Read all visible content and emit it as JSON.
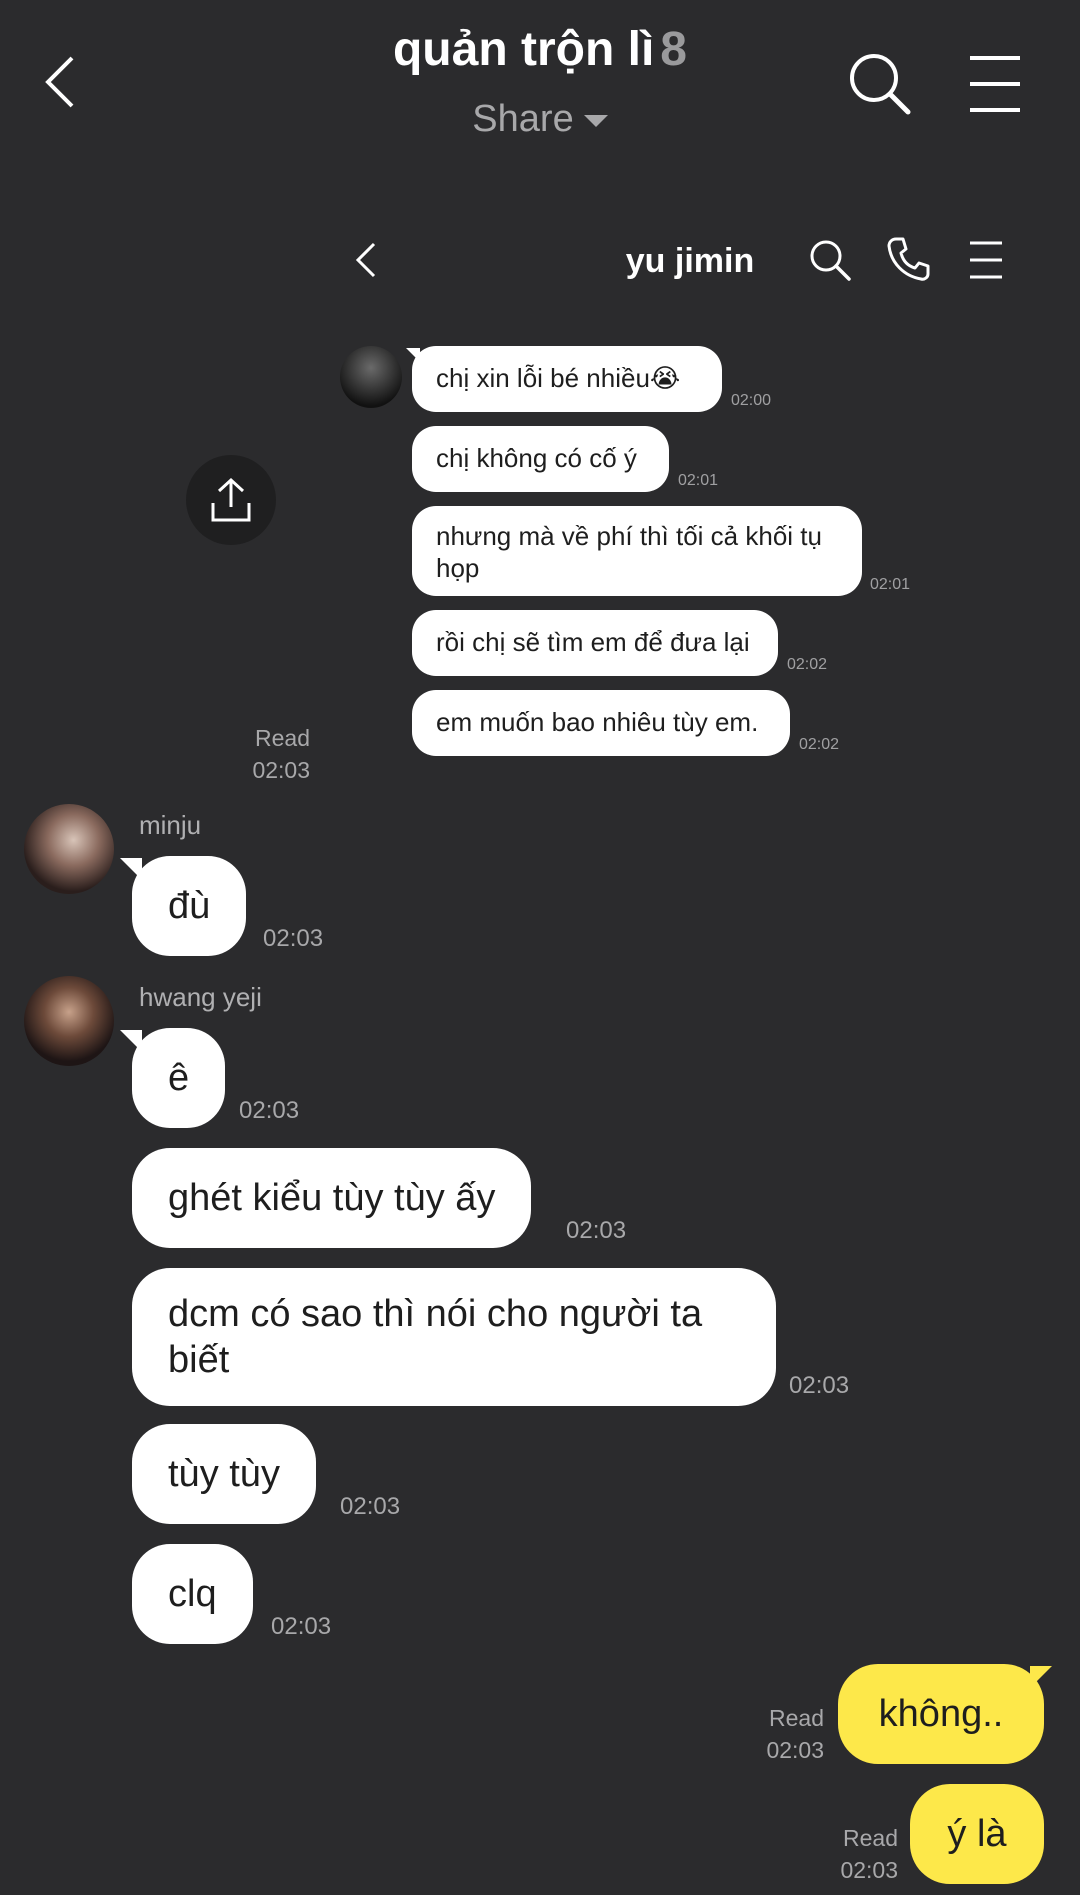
{
  "header": {
    "title": "quản trộn lì",
    "member_count": "8",
    "share_label": "Share"
  },
  "icons": {
    "back": "back-chevron-icon",
    "search": "search-icon",
    "menu": "hamburger-menu-icon",
    "phone": "phone-icon",
    "share": "share-upload-icon"
  },
  "shared_screenshot": {
    "contact_name": "yu jimin",
    "messages": [
      {
        "text": "chị xin lỗi bé nhiều😭",
        "time": "02:00"
      },
      {
        "text": "chị không có cố ý",
        "time": "02:01"
      },
      {
        "text": "nhưng mà về phí thì tối cả khối tụ họp",
        "time": "02:01"
      },
      {
        "text": "rồi chị sẽ tìm em để đưa lại",
        "time": "02:02"
      },
      {
        "text": "em muốn bao nhiêu tùy em.",
        "time": "02:02"
      }
    ],
    "read_label": "Read",
    "read_time": "02:03"
  },
  "conversation": {
    "minju": {
      "name": "minju",
      "messages": [
        {
          "text": "đù",
          "time": "02:03"
        }
      ]
    },
    "yeji": {
      "name": "hwang yeji",
      "messages": [
        {
          "text": "ê",
          "time": "02:03"
        },
        {
          "text": "ghét kiểu tùy tùy ấy",
          "time": "02:03"
        },
        {
          "text": "dcm có sao thì nói cho người ta biết",
          "time": "02:03"
        },
        {
          "text": "tùy tùy",
          "time": "02:03"
        },
        {
          "text": "clq",
          "time": "02:03"
        }
      ]
    },
    "me": {
      "messages": [
        {
          "text": "không..",
          "read": "Read",
          "time": "02:03"
        },
        {
          "text": "ý là",
          "read": "Read",
          "time": "02:03"
        }
      ]
    }
  },
  "colors": {
    "background": "#2b2b2d",
    "my_bubble": "#fde84a",
    "other_bubble": "#ffffff"
  }
}
